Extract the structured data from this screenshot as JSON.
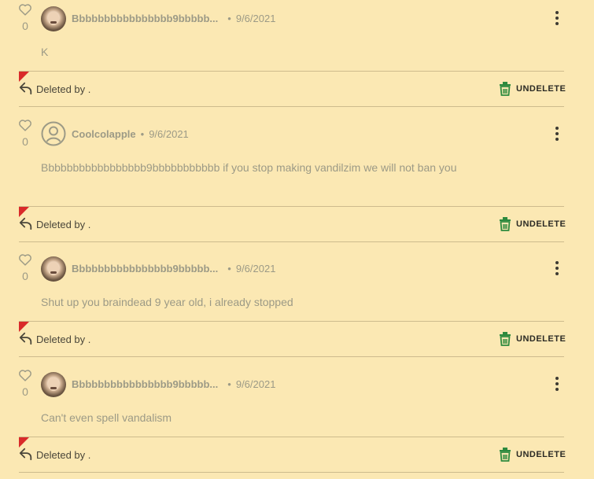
{
  "accent": {
    "flag": "#d92a2a",
    "undelete_icon": "#2d8a3e",
    "background": "#fbe8b3"
  },
  "comments": [
    {
      "author": "Bbbbbbbbbbbbbbbb9bbbbb...",
      "separator": "•",
      "date": "9/6/2021",
      "likes": "0",
      "text": "K",
      "avatar": "photo",
      "deleted_label": "Deleted by .",
      "undelete_label": "UNDELETE"
    },
    {
      "author": "Coolcolapple",
      "separator": "•",
      "date": "9/6/2021",
      "likes": "0",
      "text": "Bbbbbbbbbbbbbbbbb9bbbbbbbbbbb if you stop making vandilzim we will not ban you",
      "avatar": "default-user-icon",
      "deleted_label": "Deleted by .",
      "undelete_label": "UNDELETE"
    },
    {
      "author": "Bbbbbbbbbbbbbbbb9bbbbb...",
      "separator": "•",
      "date": "9/6/2021",
      "likes": "0",
      "text": "Shut up you braindead 9 year old, i already stopped",
      "avatar": "photo",
      "deleted_label": "Deleted by .",
      "undelete_label": "UNDELETE"
    },
    {
      "author": "Bbbbbbbbbbbbbbbb9bbbbb...",
      "separator": "•",
      "date": "9/6/2021",
      "likes": "0",
      "text": "Can't even spell vandalism",
      "avatar": "photo",
      "deleted_label": "Deleted by .",
      "undelete_label": "UNDELETE"
    }
  ]
}
